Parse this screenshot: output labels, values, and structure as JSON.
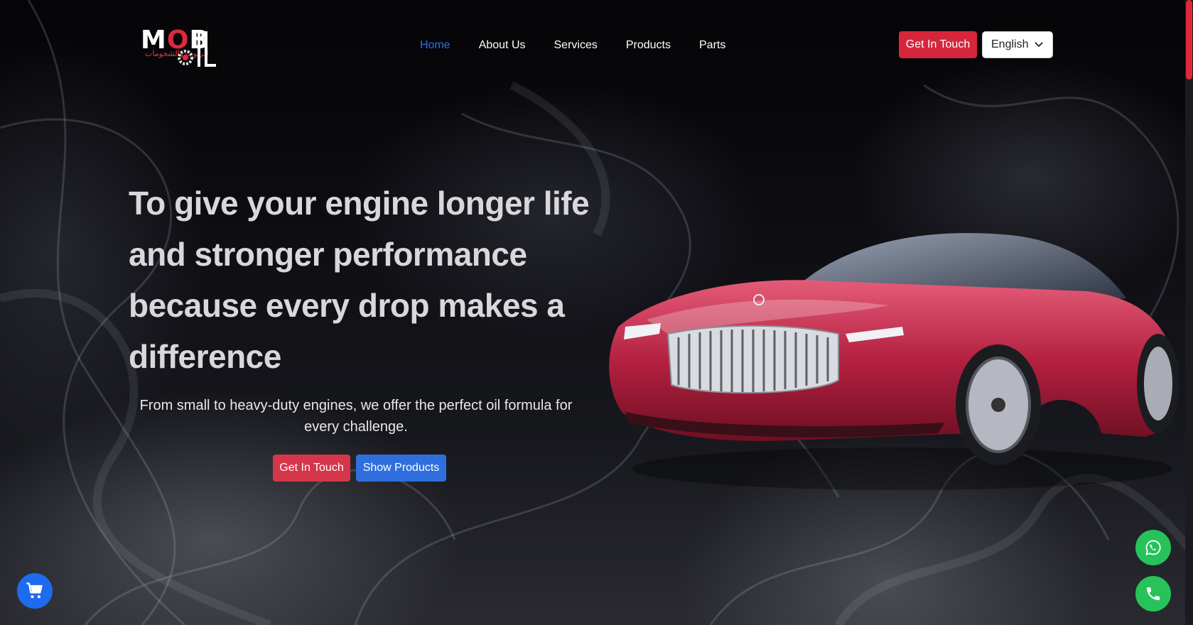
{
  "brand": {
    "logo_text_left": "M",
    "logo_text_o": "O",
    "logo_text_right": "B",
    "logo_arabic": "للزيوت والشحومات"
  },
  "nav": {
    "items": [
      {
        "label": "Home",
        "active": true
      },
      {
        "label": "About Us",
        "active": false
      },
      {
        "label": "Services",
        "active": false
      },
      {
        "label": "Products",
        "active": false
      },
      {
        "label": "Parts",
        "active": false
      }
    ]
  },
  "header": {
    "cta_label": "Get In Touch",
    "language_selected": "English"
  },
  "hero": {
    "title": "To give your engine longer life and stronger performance because every drop makes a difference",
    "subtitle": "From small to heavy-duty engines, we offer the perfect oil formula for every challenge.",
    "primary_button": "Get In Touch",
    "secondary_button": "Show Products"
  },
  "floating": {
    "whatsapp_icon": "whatsapp-icon",
    "phone_icon": "phone-icon",
    "cart_icon": "cart-icon"
  },
  "colors": {
    "accent_red": "#d6263b",
    "accent_blue": "#2f6fdd",
    "nav_active": "#2b6fe6",
    "whatsapp_green": "#27c25a"
  }
}
